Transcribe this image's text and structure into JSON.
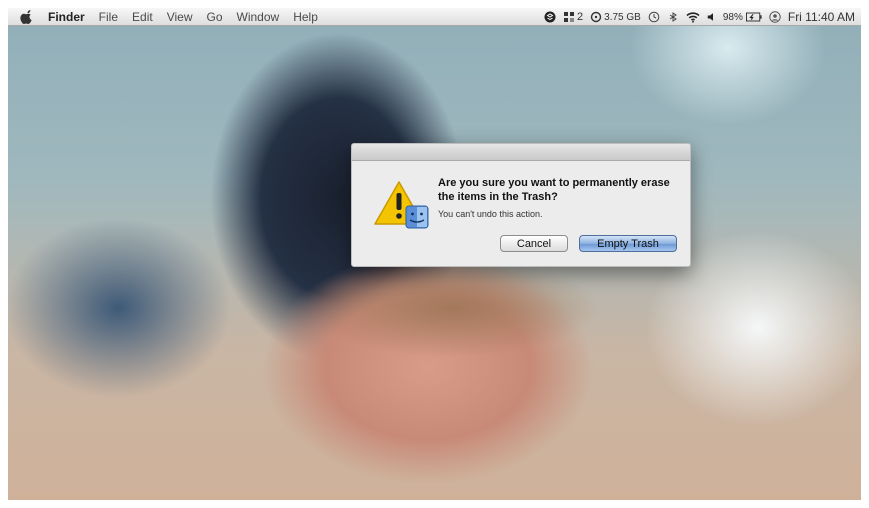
{
  "menubar": {
    "app_name": "Finder",
    "menus": [
      "File",
      "Edit",
      "View",
      "Go",
      "Window",
      "Help"
    ]
  },
  "status": {
    "spaces_count": "2",
    "free_space": "3.75 GB",
    "battery": "98%",
    "clock": "Fri 11:40 AM"
  },
  "dialog": {
    "message": "Are you sure you want to permanently erase the items in the Trash?",
    "info": "You can't undo this action.",
    "cancel_label": "Cancel",
    "confirm_label": "Empty Trash"
  },
  "colors": {
    "warning": "#f5c400",
    "default_button": "#7da6de"
  }
}
